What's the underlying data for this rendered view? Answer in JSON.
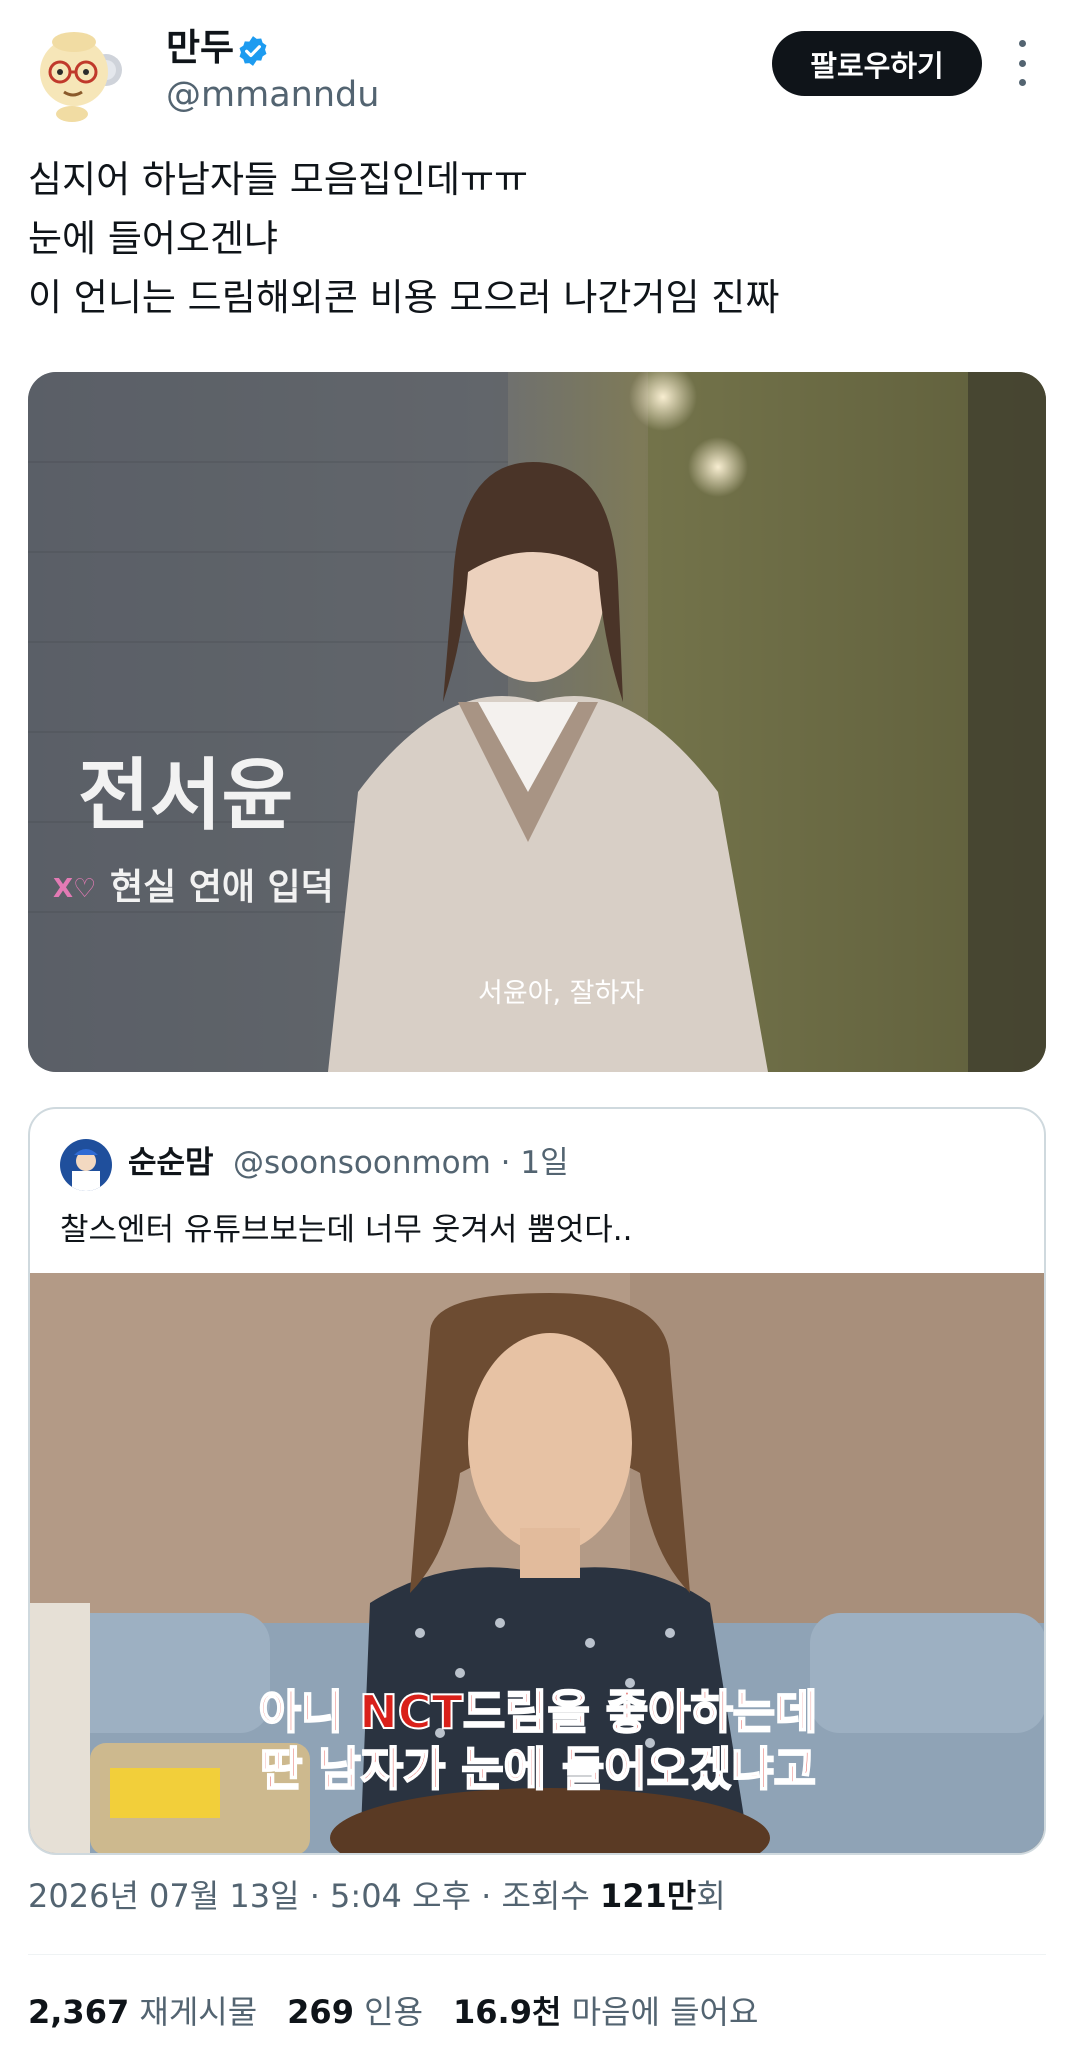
{
  "author": {
    "display_name": "만두",
    "handle": "@mmanndu",
    "avatar_icon": "cartoon-avatar-icon",
    "verified_icon": "verified-badge-icon",
    "verified_color": "#1d9bf0"
  },
  "actions": {
    "follow_label": "팔로우하기",
    "more_icon": "more-vertical-icon"
  },
  "tweet": {
    "lines": [
      "심지어 하남자들 모음집인데ㅠㅠ",
      "눈에 들어오겐냐",
      "이 언니는 드림해외콘 비용 모으러 나간거임 진짜"
    ]
  },
  "media1": {
    "caption_name": "전서윤",
    "caption_sub_logo": "X♡",
    "caption_sub": "현실 연애 입덕",
    "subtitle": "서윤아, 잘하자"
  },
  "quote": {
    "name": "순순맘",
    "handle": "@soonsoonmom · 1일",
    "text": "찰스엔터 유튜브보는데 너무 웃겨서 뿜엇다..",
    "media_subtitle_line1": "아니 NCT드림을 좋아하는데",
    "media_subtitle_line2": "딴 남자가 눈에 들어오겠냐고"
  },
  "meta": {
    "timestamp": "2026년 07월 13일 · 5:04 오후 · 조회수 ",
    "views_number": "121만",
    "views_suffix": "회"
  },
  "stats": {
    "reposts_count": "2,367",
    "reposts_label": "재게시물",
    "quotes_count": "269",
    "quotes_label": "인용",
    "likes_count": "16.9천",
    "likes_label": "마음에 들어요"
  }
}
